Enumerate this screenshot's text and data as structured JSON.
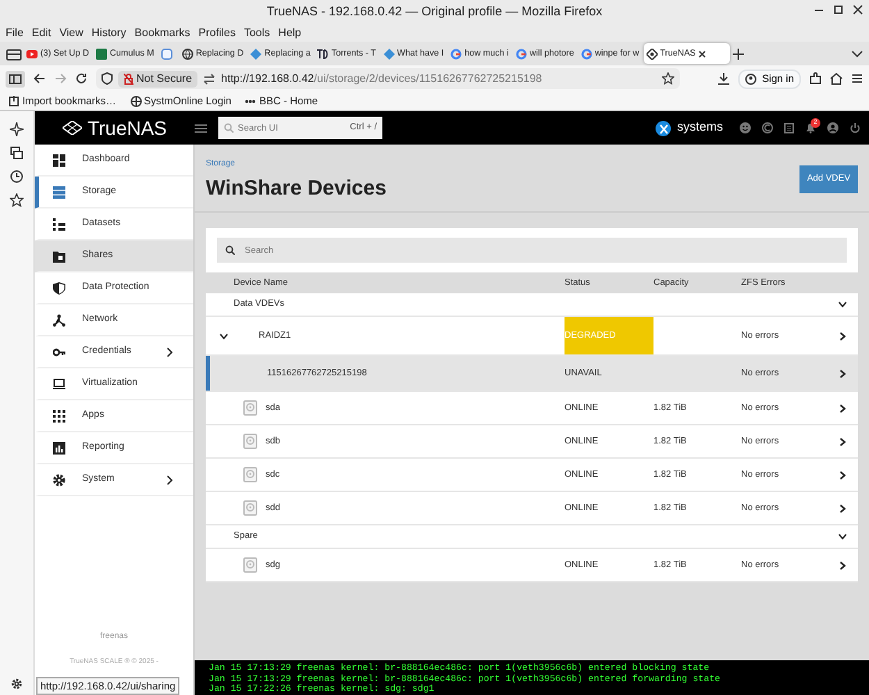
{
  "window": {
    "title": "TrueNAS - 192.168.0.42 — Original profile — Mozilla Firefox"
  },
  "menu": [
    "File",
    "Edit",
    "View",
    "History",
    "Bookmarks",
    "Profiles",
    "Tools",
    "Help"
  ],
  "tabs": [
    {
      "label": "(3) Set Up D",
      "kind": "video",
      "selected": false
    },
    {
      "label": "Cumulus M",
      "kind": "sheet",
      "selected": false
    },
    {
      "kind": "blank",
      "selected": false
    },
    {
      "label": "Replacing D",
      "kind": "globe",
      "selected": false
    },
    {
      "label": "Replacing a",
      "kind": "diamond",
      "selected": false
    },
    {
      "label": "Torrents - T",
      "kind": "td",
      "selected": false
    },
    {
      "label": "What have I",
      "kind": "diamond",
      "selected": false
    },
    {
      "label": "how much i",
      "kind": "g",
      "selected": false
    },
    {
      "label": "will photore",
      "kind": "g",
      "selected": false
    },
    {
      "label": "winpe for w",
      "kind": "g",
      "selected": false
    },
    {
      "label": "TrueNAS",
      "kind": "truenas",
      "selected": true
    }
  ],
  "address_bar": {
    "security": "Not Secure",
    "host": "http://192.168.0.42",
    "path": "/ui/storage/2/devices/11516267762725215198"
  },
  "sign_in": "Sign in",
  "bookmarks": [
    "Import bookmarks…",
    "SystmOnline Login",
    "BBC - Home"
  ],
  "topbar": {
    "logo": "TrueNAS",
    "search": {
      "placeholder": "Search UI",
      "shortcut": "Ctrl + /"
    },
    "vendor": "systems",
    "notifications": "2"
  },
  "sidebar": {
    "items": [
      {
        "label": "Dashboard",
        "selected": false,
        "hovered": false,
        "submenu": false
      },
      {
        "label": "Storage",
        "selected": true,
        "hovered": false,
        "submenu": false
      },
      {
        "label": "Datasets",
        "selected": false,
        "hovered": false,
        "submenu": false
      },
      {
        "label": "Shares",
        "selected": false,
        "hovered": true,
        "submenu": false
      },
      {
        "label": "Data Protection",
        "selected": false,
        "hovered": false,
        "submenu": false
      },
      {
        "label": "Network",
        "selected": false,
        "hovered": false,
        "submenu": false
      },
      {
        "label": "Credentials",
        "selected": false,
        "hovered": false,
        "submenu": true
      },
      {
        "label": "Virtualization",
        "selected": false,
        "hovered": false,
        "submenu": false
      },
      {
        "label": "Apps",
        "selected": false,
        "hovered": false,
        "submenu": false
      },
      {
        "label": "Reporting",
        "selected": false,
        "hovered": false,
        "submenu": false
      },
      {
        "label": "System",
        "selected": false,
        "hovered": false,
        "submenu": true
      }
    ],
    "hostname": "freenas",
    "copyright": "TrueNAS SCALE ® © 2025 -"
  },
  "breadcrumb": "Storage",
  "page_title": "WinShare Devices",
  "add_button": "Add VDEV",
  "search": {
    "placeholder": "Search"
  },
  "table": {
    "columns": [
      "Device Name",
      "Status",
      "Capacity",
      "ZFS Errors"
    ],
    "rows": [
      {
        "kind": "group",
        "name": "Data VDEVs",
        "expanded": true
      },
      {
        "kind": "vdev",
        "name": "RAIDZ1",
        "status": "DEGRADED",
        "color": "#efc800",
        "errors": "No errors",
        "expanded": true,
        "selected": false
      },
      {
        "kind": "device",
        "name": "11516267762725215198",
        "status": "UNAVAIL",
        "errors": "No errors",
        "selected": true
      },
      {
        "kind": "disk",
        "name": "sda",
        "status": "ONLINE",
        "capacity": "1.82 TiB",
        "errors": "No errors",
        "selected": false
      },
      {
        "kind": "disk",
        "name": "sdb",
        "status": "ONLINE",
        "capacity": "1.82 TiB",
        "errors": "No errors",
        "selected": false
      },
      {
        "kind": "disk",
        "name": "sdc",
        "status": "ONLINE",
        "capacity": "1.82 TiB",
        "errors": "No errors",
        "selected": false
      },
      {
        "kind": "disk",
        "name": "sdd",
        "status": "ONLINE",
        "capacity": "1.82 TiB",
        "errors": "No errors",
        "selected": false
      },
      {
        "kind": "group",
        "name": "Spare",
        "expanded": true
      },
      {
        "kind": "disk",
        "name": "sdg",
        "status": "ONLINE",
        "capacity": "1.82 TiB",
        "errors": "No errors",
        "selected": false
      }
    ]
  },
  "console": [
    "Jan 15 17:13:29 freenas kernel: br-888164ec486c: port 1(veth3956c6b) entered blocking state",
    "Jan 15 17:13:29 freenas kernel: br-888164ec486c: port 1(veth3956c6b) entered forwarding state",
    "Jan 15 17:22:26 freenas kernel:  sdg: sdg1"
  ],
  "status_link": "http://192.168.0.42/ui/sharing"
}
